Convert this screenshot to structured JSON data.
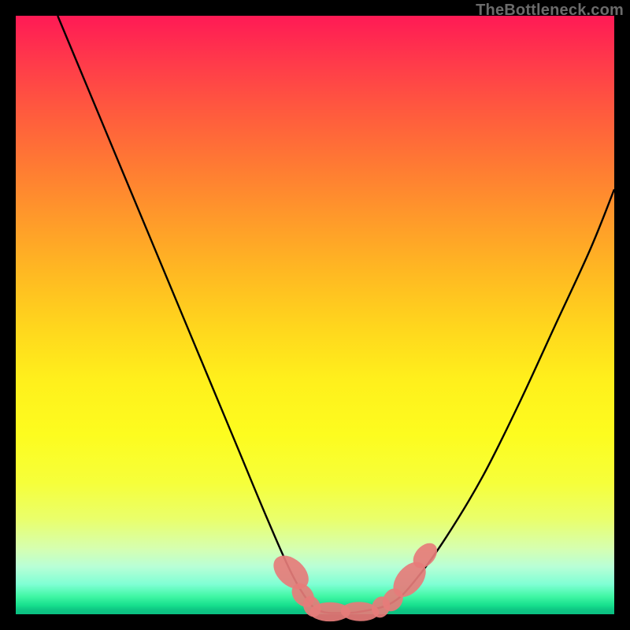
{
  "watermark": "TheBottleneck.com",
  "chart_data": {
    "type": "line",
    "title": "",
    "xlabel": "",
    "ylabel": "",
    "xlim": [
      0,
      100
    ],
    "ylim": [
      0,
      100
    ],
    "grid": false,
    "legend": false,
    "series": [
      {
        "name": "bottleneck-curve",
        "color": "#000000",
        "x": [
          7,
          12,
          17,
          22,
          27,
          32,
          37,
          42,
          46,
          49,
          51,
          54,
          58,
          63,
          67,
          72,
          78,
          84,
          90,
          96,
          100
        ],
        "y": [
          100,
          88,
          76,
          64,
          52,
          40,
          28,
          16,
          7,
          2,
          0.5,
          0.2,
          0.5,
          2,
          6,
          13,
          23,
          35,
          48,
          61,
          71
        ]
      }
    ],
    "markers": [
      {
        "name": "marker-1",
        "x": 46.0,
        "y": 7.0,
        "rx": 2.2,
        "ry": 3.4,
        "angle": -48
      },
      {
        "name": "marker-2",
        "x": 48.0,
        "y": 3.2,
        "rx": 1.6,
        "ry": 2.2,
        "angle": -40
      },
      {
        "name": "marker-3",
        "x": 49.5,
        "y": 1.3,
        "rx": 1.4,
        "ry": 1.8,
        "angle": -25
      },
      {
        "name": "marker-4",
        "x": 52.5,
        "y": 0.4,
        "rx": 3.4,
        "ry": 1.6,
        "angle": 0
      },
      {
        "name": "marker-5",
        "x": 57.5,
        "y": 0.45,
        "rx": 3.2,
        "ry": 1.6,
        "angle": 2
      },
      {
        "name": "marker-6",
        "x": 61.0,
        "y": 1.2,
        "rx": 1.5,
        "ry": 1.8,
        "angle": 20
      },
      {
        "name": "marker-7",
        "x": 63.0,
        "y": 2.4,
        "rx": 1.6,
        "ry": 2.0,
        "angle": 30
      },
      {
        "name": "marker-8",
        "x": 65.8,
        "y": 5.8,
        "rx": 2.1,
        "ry": 3.4,
        "angle": 40
      },
      {
        "name": "marker-9",
        "x": 68.4,
        "y": 9.8,
        "rx": 1.6,
        "ry": 2.4,
        "angle": 42
      }
    ],
    "marker_color": "#e67c7a",
    "background_gradient": {
      "top": "#ff1a55",
      "mid": "#ffe81c",
      "bottom": "#0abf82"
    }
  }
}
